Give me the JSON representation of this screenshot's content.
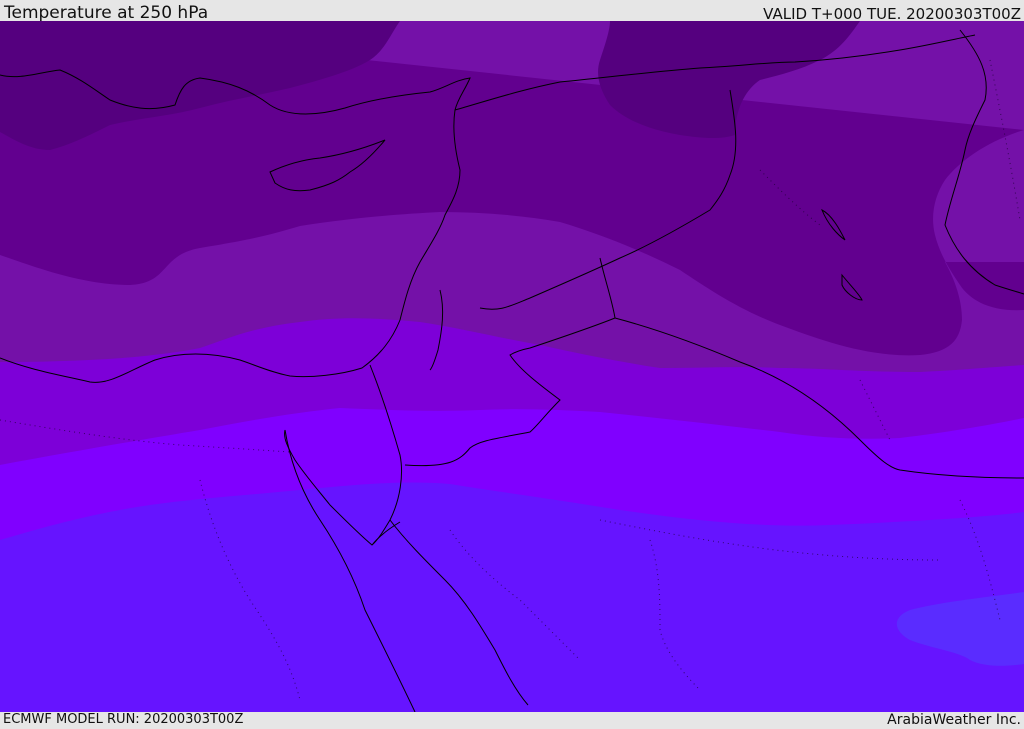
{
  "header": {
    "title": "Temperature at 250 hPa",
    "valid": "VALID T+000 TUE. 20200303T00Z"
  },
  "footer": {
    "model_run": "ECMWF MODEL RUN: 20200303T00Z",
    "credit": "ArabiaWeather Inc."
  },
  "colors": {
    "coldest": "#55007f",
    "cold": "#62008f",
    "cool": "#7411a8",
    "mid": "#7d00d8",
    "warm": "#8000ff",
    "warmer": "#6614ff",
    "warmest": "#5a2cff",
    "coast": "#000000",
    "bar": "#e6e6e6"
  }
}
